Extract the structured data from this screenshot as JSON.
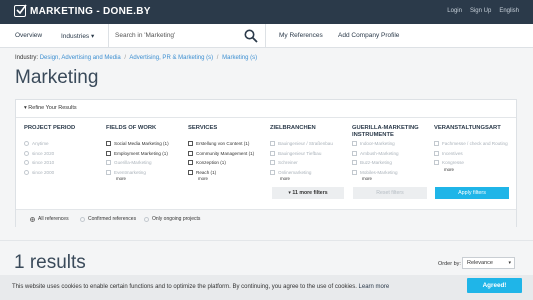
{
  "header": {
    "logo_text": "MARKETING - DONE.BY",
    "links": [
      "Login",
      "Sign Up",
      "English"
    ]
  },
  "nav": {
    "overview": "Overview",
    "industries": "Industries",
    "search_value": "Search in 'Marketing'",
    "my_references": "My References",
    "add_company": "Add Company Profile"
  },
  "breadcrumb": {
    "prefix": "Industry:",
    "items": [
      "Design, Advertising and Media",
      "Advertising, PR & Marketing (s)",
      "Marketing (s)"
    ]
  },
  "page_title": "Marketing",
  "refine": {
    "title": "Refine Your Results",
    "columns": [
      {
        "heading": "PROJECT PERIOD",
        "type": "radio",
        "options": [
          {
            "label": "Anytime",
            "disabled": true
          },
          {
            "label": "since 2020",
            "disabled": true
          },
          {
            "label": "since 2010",
            "disabled": true
          },
          {
            "label": "since 2000",
            "disabled": true
          }
        ],
        "more": ""
      },
      {
        "heading": "FIELDS OF WORK",
        "type": "check",
        "options": [
          {
            "label": "Social Media Marketing (1)",
            "disabled": false
          },
          {
            "label": "Employment Marketing (1)",
            "disabled": false
          },
          {
            "label": "Guerilla-Marketing",
            "disabled": true
          },
          {
            "label": "Eventmarketing",
            "disabled": true
          }
        ],
        "more": "more"
      },
      {
        "heading": "SERVICES",
        "type": "check",
        "options": [
          {
            "label": "Erstellung von Content (1)",
            "disabled": false
          },
          {
            "label": "Community Management (1)",
            "disabled": false
          },
          {
            "label": "Konzeption (1)",
            "disabled": false
          },
          {
            "label": "Reach (1)",
            "disabled": false
          }
        ],
        "more": "more"
      },
      {
        "heading": "ZIELBRANCHEN",
        "type": "check",
        "options": [
          {
            "label": "Bauingenieur / Straßenbau",
            "disabled": true
          },
          {
            "label": "Bauingenieur Tiefbau",
            "disabled": true
          },
          {
            "label": "Schreiner",
            "disabled": true
          },
          {
            "label": "Onlinemarketing",
            "disabled": true
          }
        ],
        "more": "more"
      },
      {
        "heading": "GUERILLA-MARKETING INSTRUMENTE",
        "type": "check",
        "options": [
          {
            "label": "Indoor-Marketing",
            "disabled": true
          },
          {
            "label": "Ambush-Marketing",
            "disabled": true
          },
          {
            "label": "Buzz-Marketing",
            "disabled": true
          },
          {
            "label": "Mobiles-Marketing",
            "disabled": true
          }
        ],
        "more": "more"
      },
      {
        "heading": "VERANSTALTUNGSART",
        "type": "check",
        "options": [
          {
            "label": "Fachmesse / check and Routing",
            "disabled": true
          },
          {
            "label": "Incentives",
            "disabled": true
          },
          {
            "label": "Kongresse",
            "disabled": true
          }
        ],
        "more": "more"
      }
    ],
    "more_filters": "11 more filters",
    "reset_label": "Reset filters",
    "apply_label": "Apply filters",
    "scope_options": [
      {
        "label": "All references",
        "selected": true
      },
      {
        "label": "Confirmed references",
        "selected": false
      },
      {
        "label": "Only ongoing projects",
        "selected": false
      }
    ]
  },
  "results": {
    "count_text": "1 results",
    "order_label": "Order by:",
    "order_value": "Relevance"
  },
  "cookie": {
    "text": "This website uses cookies to enable certain functions and to optimize the platform. By continuing, you agree to the use of cookies.",
    "learn_more": "Learn more",
    "accept": "Agreed!"
  },
  "colors": {
    "topbar": "#2b3a4a",
    "accent": "#1fb5e8",
    "link": "#3d8fd1"
  }
}
